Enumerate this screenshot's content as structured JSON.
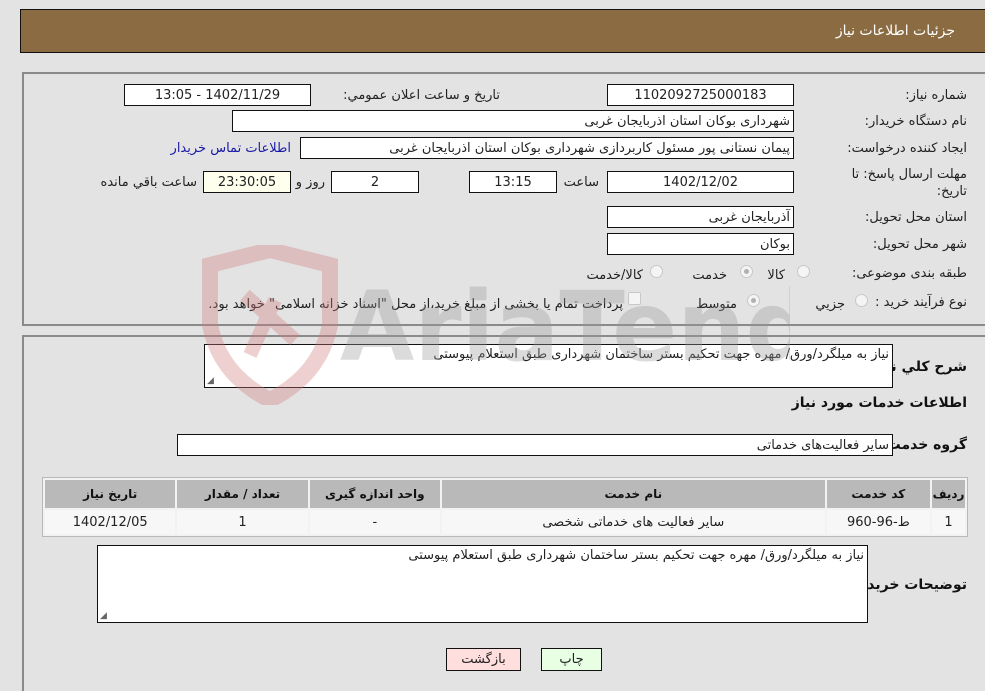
{
  "header": {
    "title": "جزئیات اطلاعات نیاز"
  },
  "form": {
    "need_number_label": "شماره نیاز:",
    "need_number": "1102092725000183",
    "announce_label": "تاریخ و ساعت اعلان عمومي:",
    "announce_value": "1402/11/29 - 13:05",
    "buyer_org_label": "نام دستگاه خریدار:",
    "buyer_org": "شهرداری بوکان استان اذربایجان غربی",
    "creator_label": "ایجاد کننده درخواست:",
    "creator": "پیمان نستانی پور مسئول کاربردازی شهرداری بوکان استان اذربایجان غربی",
    "contact_link": "اطلاعات تماس خریدار",
    "deadline_label": "مهلت ارسال پاسخ: تا تاریخ:",
    "deadline_date": "1402/12/02",
    "time_label": "ساعت",
    "deadline_time": "13:15",
    "days_value": "2",
    "days_label": "روز و",
    "remaining_time": "23:30:05",
    "remaining_label": "ساعت باقي مانده",
    "province_label": "استان محل تحویل:",
    "province": "آذربایجان غربی",
    "city_label": "شهر محل تحویل:",
    "city": "بوکان",
    "category_label": "طبقه بندی موضوعی:",
    "category_options": [
      {
        "label": "کالا",
        "checked": false
      },
      {
        "label": "خدمت",
        "checked": true
      },
      {
        "label": "کالا/خدمت",
        "checked": false
      }
    ],
    "process_label": "نوع فرآیند خرید :",
    "process_options": [
      {
        "label": "جزيي",
        "checked": false
      },
      {
        "label": "متوسط",
        "checked": true
      }
    ],
    "payment_note": "پرداخت تمام یا بخشی از مبلغ خرید،از محل \"اسناد خزانه اسلامی\" خواهد بود."
  },
  "details": {
    "summary_label": "شرح کلي نياز:",
    "summary": "نیاز به میلگرد/ورق/ مهره جهت  تحکیم بستر ساختمان شهرداری طبق استعلام پیوستی",
    "services_heading": "اطلاعات خدمات مورد نياز",
    "service_group_label": "گروه خدمت:",
    "service_group": "سایر فعالیت‌های خدماتی",
    "table": {
      "columns": [
        "رديف",
        "کد خدمت",
        "نام خدمت",
        "واحد اندازه گيری",
        "تعداد / مقدار",
        "تاريخ نياز"
      ],
      "rows": [
        [
          "1",
          "ط-96-960",
          "سایر فعالیت های خدماتی شخصی",
          "-",
          "1",
          "1402/12/05"
        ]
      ]
    },
    "buyer_notes_label": "توضيحات خريدار:",
    "buyer_notes": "نیاز به میلگرد/ورق/ مهره جهت  تحکیم بستر ساختمان شهرداری طبق استعلام پیوستی"
  },
  "buttons": {
    "print": "چاپ",
    "back": "بازگشت"
  },
  "watermark": {
    "text": "AriaTender.neT"
  },
  "colors": {
    "header_bg": "#8b6b42",
    "link": "#1a1aa8",
    "back_btn": "#ffdede",
    "print_btn": "#e8ffe4"
  }
}
